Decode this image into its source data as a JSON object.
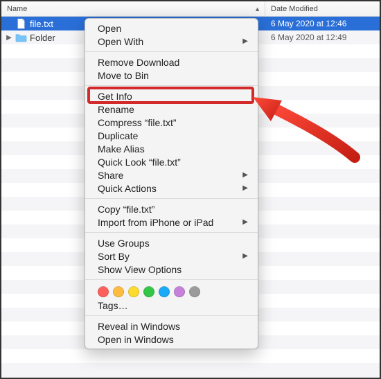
{
  "columns": {
    "name_label": "Name",
    "date_label": "Date Modified"
  },
  "rows": [
    {
      "kind": "file",
      "name": "file.txt",
      "date": "6 May 2020 at 12:46",
      "selected": true,
      "expandable": false
    },
    {
      "kind": "folder",
      "name": "Folder",
      "date": "6 May 2020 at 12:49",
      "selected": false,
      "expandable": true
    }
  ],
  "context_menu": {
    "groups": [
      [
        {
          "label": "Open",
          "submenu": false
        },
        {
          "label": "Open With",
          "submenu": true
        }
      ],
      [
        {
          "label": "Remove Download",
          "submenu": false
        },
        {
          "label": "Move to Bin",
          "submenu": false
        }
      ],
      [
        {
          "label": "Get Info",
          "submenu": false,
          "highlight": true
        },
        {
          "label": "Rename",
          "submenu": false
        },
        {
          "label": "Compress “file.txt”",
          "submenu": false
        },
        {
          "label": "Duplicate",
          "submenu": false
        },
        {
          "label": "Make Alias",
          "submenu": false
        },
        {
          "label": "Quick Look “file.txt”",
          "submenu": false
        },
        {
          "label": "Share",
          "submenu": true
        },
        {
          "label": "Quick Actions",
          "submenu": true
        }
      ],
      [
        {
          "label": "Copy “file.txt”",
          "submenu": false
        },
        {
          "label": "Import from iPhone or iPad",
          "submenu": true
        }
      ],
      [
        {
          "label": "Use Groups",
          "submenu": false
        },
        {
          "label": "Sort By",
          "submenu": true
        },
        {
          "label": "Show View Options",
          "submenu": false
        }
      ]
    ],
    "tags_label": "Tags…",
    "tag_colors": [
      "#fc605c",
      "#fdbc40",
      "#fddb2e",
      "#33c748",
      "#1aaaf8",
      "#c681da",
      "#9b9b9b"
    ],
    "footer": [
      {
        "label": "Reveal in Windows",
        "submenu": false
      },
      {
        "label": "Open in Windows",
        "submenu": false
      }
    ]
  }
}
